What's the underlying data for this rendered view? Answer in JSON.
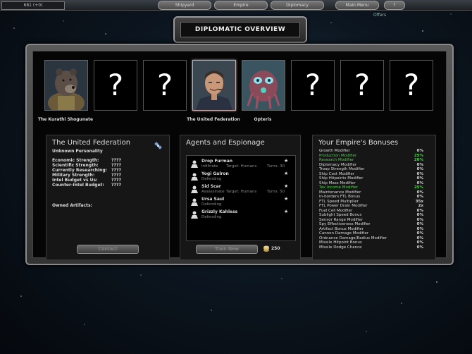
{
  "topbar": {
    "credits": "681 (+0)",
    "nav": [
      "Shipyard",
      "Empire",
      "Diplomacy",
      "Main Menu",
      "?"
    ],
    "turn_link": "Offers"
  },
  "title": "DIPLOMATIC OVERVIEW",
  "factions": [
    {
      "name": "The Kurathi Shogunate",
      "known": true,
      "portrait": "bear-icon"
    },
    {
      "name": "",
      "known": false,
      "glyph": "?"
    },
    {
      "name": "",
      "known": false,
      "glyph": "?"
    },
    {
      "name": "The United Federation",
      "known": true,
      "portrait": "human-portrait",
      "selected": true
    },
    {
      "name": "Opteris",
      "known": true,
      "portrait": "alien-icon"
    },
    {
      "name": "",
      "known": false,
      "glyph": "?"
    },
    {
      "name": "",
      "known": false,
      "glyph": "?"
    },
    {
      "name": "",
      "known": false,
      "glyph": "?"
    }
  ],
  "faction_panel": {
    "title": "The United Federation",
    "personality": "Unknown Personality",
    "stats": [
      {
        "label": "Economic Strength:",
        "value": "????"
      },
      {
        "label": "Scientific Strength:",
        "value": "????"
      },
      {
        "label": "Currently Researching:",
        "value": "????"
      },
      {
        "label": "Military Strength:",
        "value": "????"
      },
      {
        "label": "Intel Budget vs Us:",
        "value": "????"
      },
      {
        "label": "Counter-Intel Budget:",
        "value": "????"
      }
    ],
    "owned_artifacts_label": "Owned Artifacts:",
    "contact_button": "Contact"
  },
  "agents_panel": {
    "title": "Agents and Espionage",
    "agents": [
      {
        "name": "Drop Furman",
        "activity": "Infiltrate",
        "target": "Target: Humans",
        "turns": "Turns: 30",
        "star": "★"
      },
      {
        "name": "Yogi Galron",
        "activity": "Defending",
        "target": "",
        "turns": "",
        "star": "★"
      },
      {
        "name": "Sid Scar",
        "activity": "Assassinate",
        "target": "Target: Humans",
        "turns": "Turns: 50",
        "star": "★"
      },
      {
        "name": "Ursa Saul",
        "activity": "Defending",
        "target": "",
        "turns": "",
        "star": "★"
      },
      {
        "name": "Grizzly Kahless",
        "activity": "Defending",
        "target": "",
        "turns": "",
        "star": "★"
      }
    ],
    "train_button": "Train New",
    "cost": "250"
  },
  "bonuses_panel": {
    "title": "Your Empire's Bonuses",
    "rows": [
      {
        "label": "Growth Modifier",
        "value": "0%",
        "hl": false
      },
      {
        "label": "Production Modifier",
        "value": "25%",
        "hl": true
      },
      {
        "label": "Research Modifier",
        "value": "20%",
        "hl": true
      },
      {
        "label": "Diplomacy Modifier",
        "value": "0%",
        "hl": false
      },
      {
        "label": "Troop Strength Modifier",
        "value": "0%",
        "hl": false
      },
      {
        "label": "Ship Cost Modifier",
        "value": "0%",
        "hl": false
      },
      {
        "label": "Ship Hitpoints Modifier",
        "value": "0%",
        "hl": false
      },
      {
        "label": "Ship Mass Modifier",
        "value": "0%",
        "hl": false
      },
      {
        "label": "Tax Income Modifier",
        "value": "25%",
        "hl": true
      },
      {
        "label": "Maintenance Modifier",
        "value": "0%",
        "hl": false
      },
      {
        "label": "In-borders FTL Bonus",
        "value": "0%",
        "hl": false
      },
      {
        "label": "FTL Speed Multiplier",
        "value": "35x",
        "hl": false
      },
      {
        "label": "FTL Power Drain Modifier",
        "value": "2x",
        "hl": false
      },
      {
        "label": "Fuel Cell Modifier",
        "value": "0%",
        "hl": false
      },
      {
        "label": "Sublight Speed Bonus",
        "value": "0%",
        "hl": false
      },
      {
        "label": "Sensor Range Modifier",
        "value": "0%",
        "hl": false
      },
      {
        "label": "Spy Effectiveness Modifier",
        "value": "0%",
        "hl": false
      },
      {
        "label": "Artifact Bonus Modifier",
        "value": "0%",
        "hl": false
      },
      {
        "label": "Cannon Damage Modifier",
        "value": "0%",
        "hl": false
      },
      {
        "label": "Ordnance Damage/Radius Modifier",
        "value": "0%",
        "hl": false
      },
      {
        "label": "Missile Hitpoint Bonus",
        "value": "0%",
        "hl": false
      },
      {
        "label": "Missile Dodge Chance",
        "value": "0%",
        "hl": false
      }
    ]
  }
}
